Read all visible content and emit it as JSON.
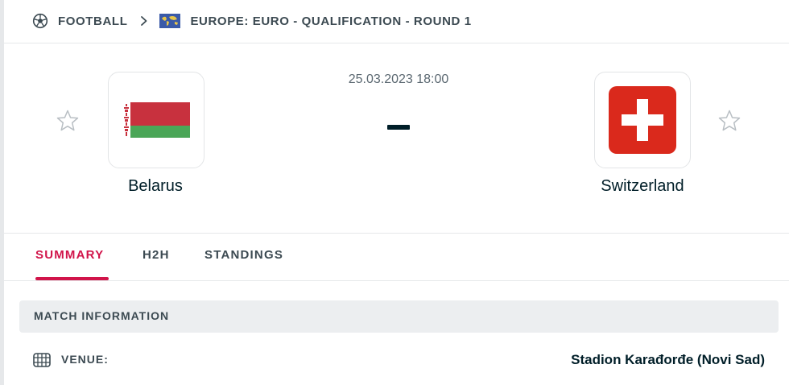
{
  "breadcrumb": {
    "sport": "FOOTBALL",
    "tournament": "EUROPE: EURO - QUALIFICATION - ROUND 1"
  },
  "match": {
    "start_time": "25.03.2023 18:00",
    "score": "-",
    "home_team": {
      "name": "Belarus"
    },
    "away_team": {
      "name": "Switzerland"
    }
  },
  "tabs": [
    {
      "label": "SUMMARY",
      "active": true
    },
    {
      "label": "H2H",
      "active": false
    },
    {
      "label": "STANDINGS",
      "active": false
    }
  ],
  "match_info": {
    "title": "MATCH INFORMATION",
    "venue_label": "VENUE:",
    "venue_value": "Stadion Karađorđe (Novi Sad)"
  },
  "colors": {
    "accent": "#d1144a",
    "text_primary": "#001e28",
    "text_secondary": "#3c4a52",
    "belarus_red": "#c8313e",
    "belarus_green": "#4aa657",
    "swiss_red": "#da291c"
  },
  "icons": {
    "sport": "football-icon",
    "separator": "chevron-right-icon",
    "tournament_flag": "world-flag-icon",
    "favorite": "star-outline-icon",
    "venue": "stadium-icon"
  }
}
